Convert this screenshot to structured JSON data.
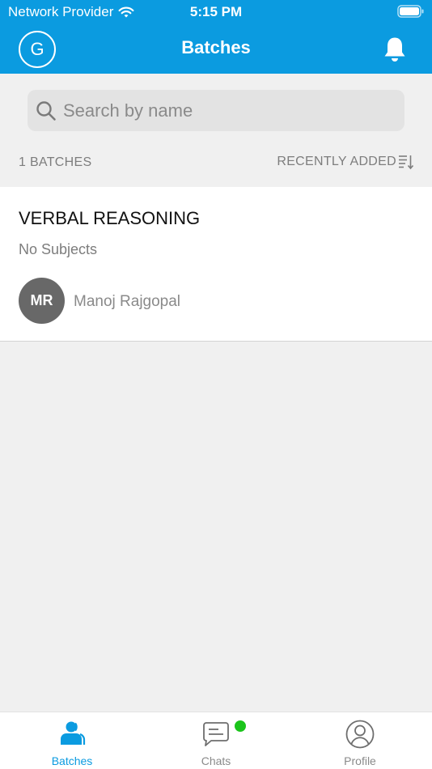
{
  "status_bar": {
    "carrier": "Network Provider",
    "time": "5:15 PM"
  },
  "header": {
    "avatar_initial": "G",
    "title": "Batches"
  },
  "search": {
    "placeholder": "Search by name",
    "value": ""
  },
  "list_meta": {
    "count_label": "1 BATCHES",
    "sort_label": "RECENTLY ADDED"
  },
  "batches": [
    {
      "name": "VERBAL REASONING",
      "subjects": "No Subjects",
      "teacher_initials": "MR",
      "teacher_name": "Manoj Rajgopal"
    }
  ],
  "tab_bar": {
    "tabs": [
      {
        "label": "Batches",
        "icon": "batches-icon",
        "active": true
      },
      {
        "label": "Chats",
        "icon": "chat-icon",
        "active": false,
        "has_notification_dot": true
      },
      {
        "label": "Profile",
        "icon": "profile-icon",
        "active": false
      }
    ]
  },
  "colors": {
    "primary": "#0b9be0",
    "notification_dot": "#1bc41b",
    "background": "#f0f0f0",
    "avatar_bg": "#686868"
  }
}
